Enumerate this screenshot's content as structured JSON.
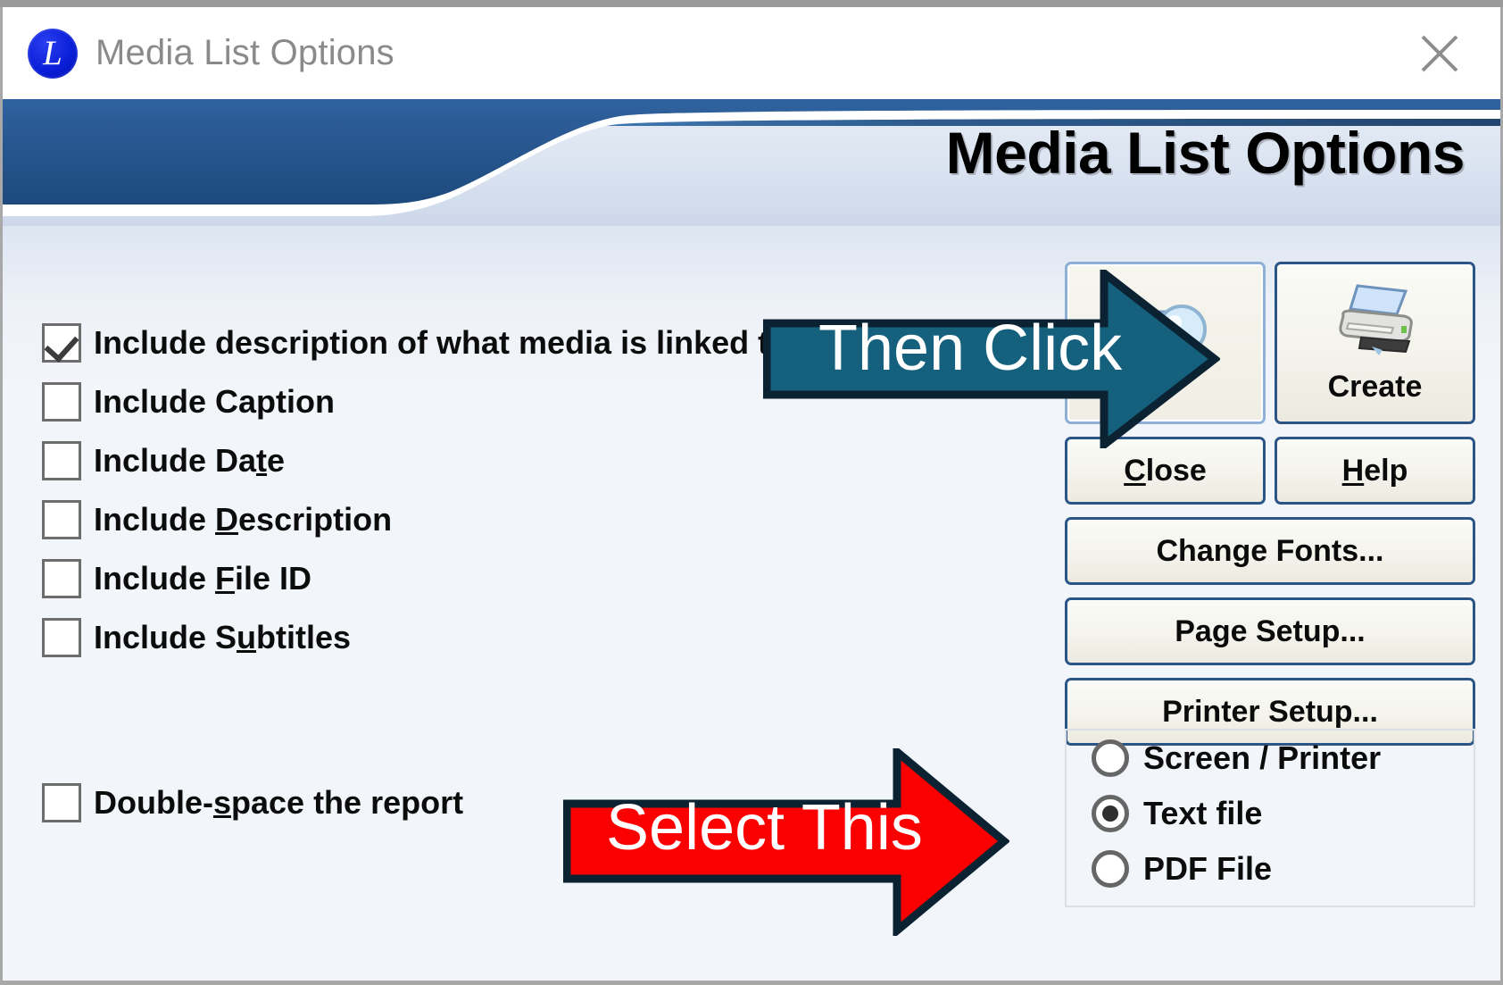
{
  "window": {
    "title": "Media List Options",
    "logo_letter": "L",
    "close_icon": "close-icon"
  },
  "banner": {
    "heading": "Media List Options",
    "colors": {
      "dark_blue": "#1f4f86",
      "mid_blue": "#3d76b6",
      "light_blue": "#ccd9ec"
    }
  },
  "options": {
    "checkboxes": [
      {
        "label": "Include description of what media is linked to",
        "mnemonic": "",
        "checked": true
      },
      {
        "label": "Include Caption",
        "mnemonic": "",
        "checked": false
      },
      {
        "label": "Include Da",
        "mnemonic": "t",
        "label_after": "e",
        "checked": false
      },
      {
        "label": "Include ",
        "mnemonic": "D",
        "label_after": "escription",
        "checked": false
      },
      {
        "label": "Include ",
        "mnemonic": "F",
        "label_after": "ile ID",
        "checked": false
      },
      {
        "label": "Include S",
        "mnemonic": "u",
        "label_after": "btitles",
        "checked": false
      }
    ],
    "double_space": {
      "label": "Double-",
      "mnemonic": "s",
      "label_after": "pace the report",
      "checked": false
    }
  },
  "buttons": {
    "preview": {
      "label": "",
      "icon": "preview-magnifier-icon"
    },
    "create": {
      "label": "Create",
      "icon": "printer-icon"
    },
    "close": {
      "label": "C",
      "mnemonic_after": "lose"
    },
    "help": {
      "label": "H",
      "mnemonic_after": "elp"
    },
    "change_fonts": "Change Fonts...",
    "page_setup": "Page Setup...",
    "printer_setup": "Printer Setup..."
  },
  "output_destination": {
    "options": [
      {
        "label": "Screen / Printer",
        "selected": false
      },
      {
        "label": "Text file",
        "selected": true
      },
      {
        "label": "PDF File",
        "selected": false
      }
    ]
  },
  "annotations": [
    {
      "text": "Then Click",
      "fill": "#14607d",
      "stroke": "#0b2233",
      "points_to": "create-button"
    },
    {
      "text": "Select This",
      "fill": "#fa0000",
      "stroke": "#0b2233",
      "points_to": "radio-text-file"
    }
  ]
}
